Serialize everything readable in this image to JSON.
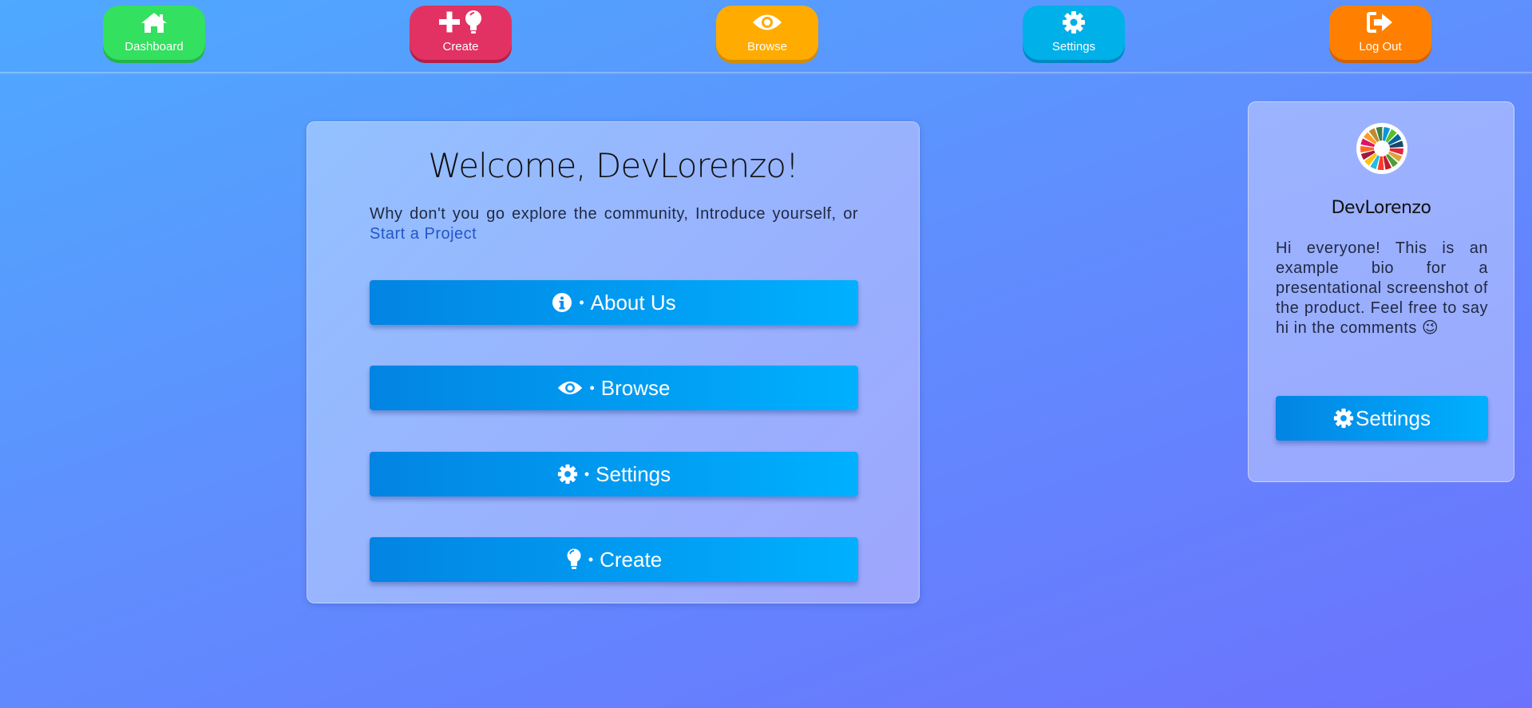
{
  "nav": {
    "items": [
      {
        "label": "Dashboard",
        "icon": "home-icon",
        "color": "#33e05f"
      },
      {
        "label": "Create",
        "icon": "plus-lightbulb-icon",
        "color": "#e23263"
      },
      {
        "label": "Browse",
        "icon": "eye-icon",
        "color": "#ffab00"
      },
      {
        "label": "Settings",
        "icon": "gear-icon",
        "color": "#00b0e8"
      },
      {
        "label": "Log Out",
        "icon": "sign-out-icon",
        "color": "#ff8000"
      }
    ]
  },
  "welcome": {
    "title": "Welcome, DevLorenzo!",
    "intro_text": "Why don't you go explore the community, Introduce yourself, or ",
    "intro_link": "Start a Project",
    "buttons": [
      {
        "label": "About Us",
        "icon": "info-circle-icon"
      },
      {
        "label": "Browse",
        "icon": "eye-icon"
      },
      {
        "label": "Settings",
        "icon": "gear-icon"
      },
      {
        "label": "Create",
        "icon": "lightbulb-icon"
      }
    ],
    "separator": "•"
  },
  "profile": {
    "username": "DevLorenzo",
    "bio": "Hi everyone! This is an example bio for a presentational screenshot of the product. Feel free to say hi in the comments 😉",
    "settings_label": "Settings",
    "avatar_icon": "color-wheel-avatar"
  },
  "colors": {
    "button_gradient_start": "#0284e3",
    "button_gradient_end": "#00b0ff",
    "link": "#2455c8"
  }
}
